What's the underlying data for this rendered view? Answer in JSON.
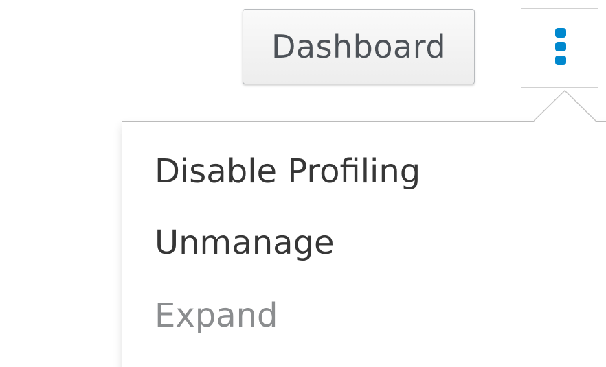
{
  "toolbar": {
    "dashboard_label": "Dashboard",
    "kebab_icon": "kebab-vertical-icon",
    "accent_color": "#0088ce"
  },
  "menu": {
    "items": [
      {
        "label": "Disable Profiling",
        "disabled": false
      },
      {
        "label": "Unmanage",
        "disabled": false
      },
      {
        "label": "Expand",
        "disabled": true
      }
    ]
  }
}
